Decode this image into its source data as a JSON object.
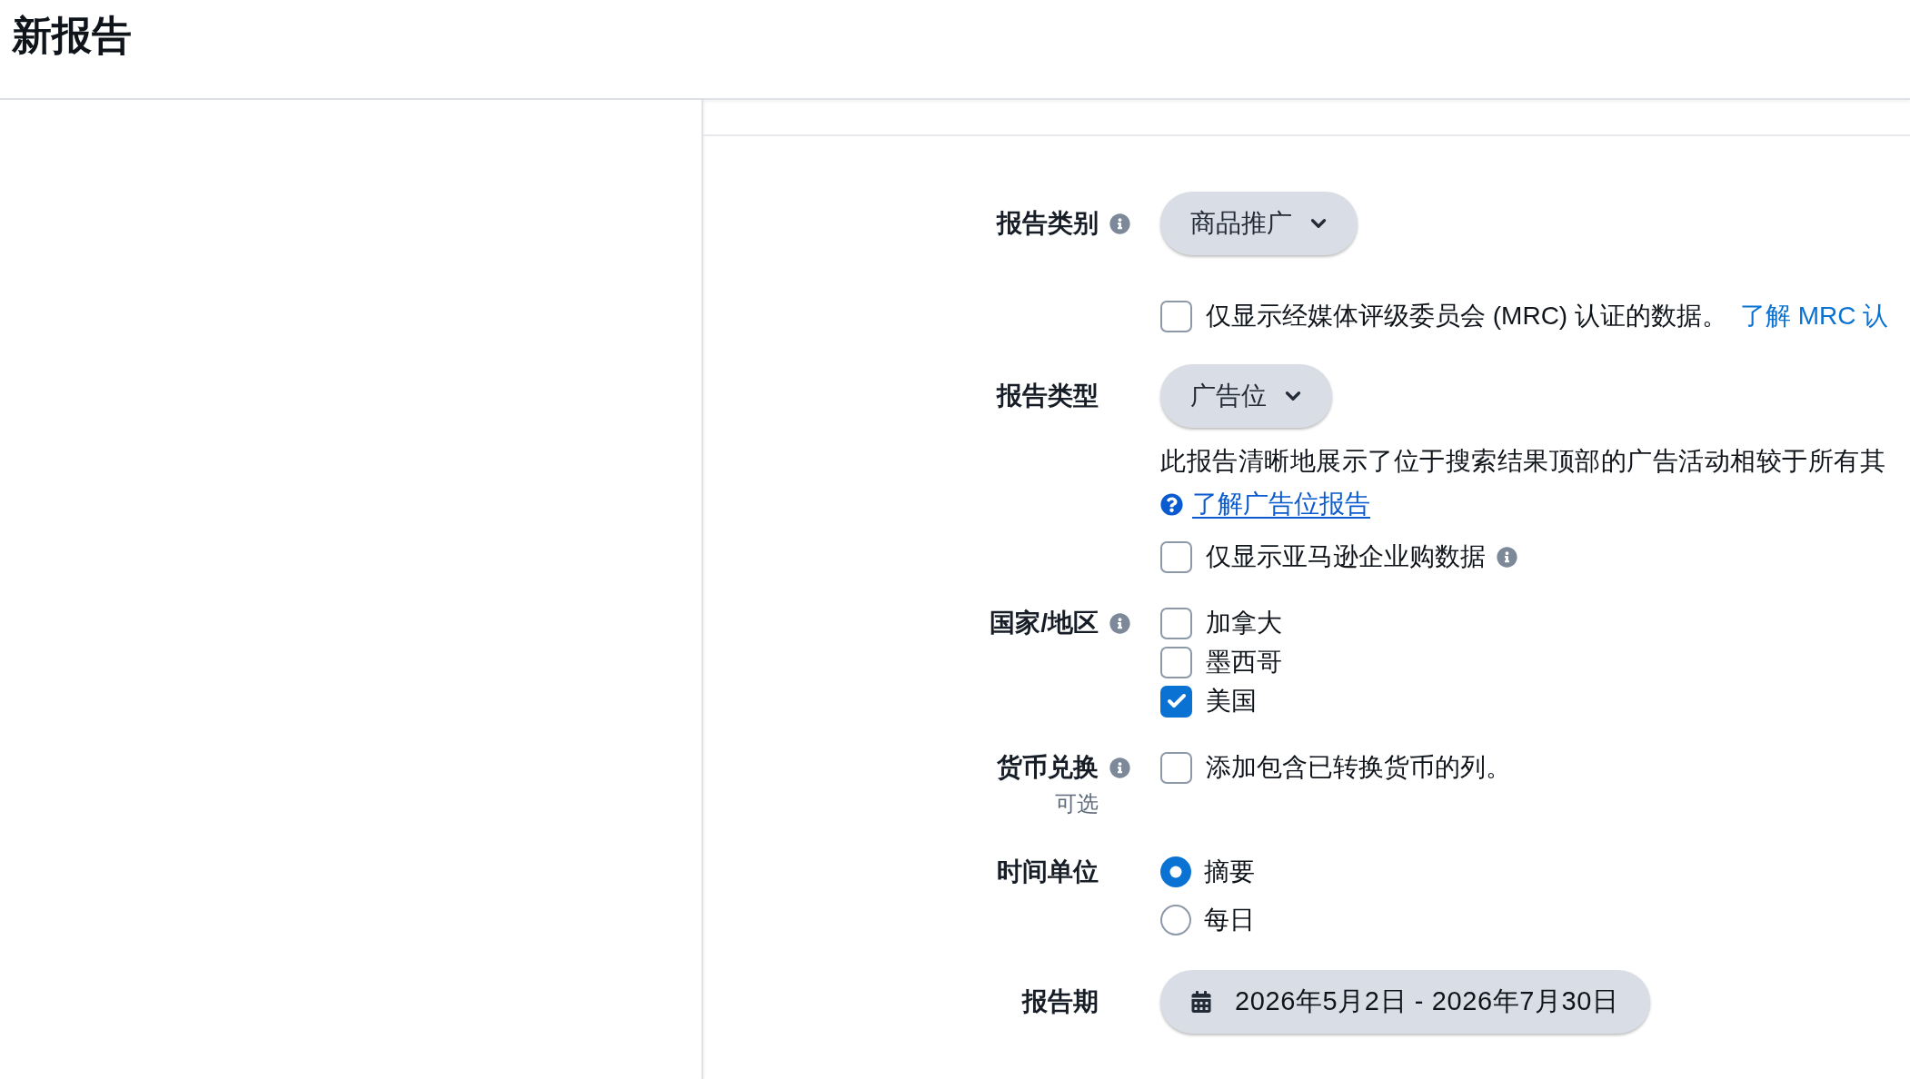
{
  "header": {
    "title": "新报告"
  },
  "fields": [
    {
      "kind": "select",
      "label": "报告类别",
      "info": true,
      "value": "商品推广",
      "extras": [
        {
          "kind": "checkbox",
          "text": "仅显示经媒体评级委员会 (MRC) 认证的数据。",
          "checked": false,
          "info": false,
          "link": "了解 MRC 认"
        }
      ]
    },
    {
      "kind": "select",
      "label": "报告类型",
      "info": false,
      "value": "广告位",
      "extras": [
        {
          "kind": "description",
          "text": "此报告清晰地展示了位于搜索结果顶部的广告活动相较于所有其"
        },
        {
          "kind": "help_link",
          "text": "了解广告位报告"
        },
        {
          "kind": "checkbox",
          "text": "仅显示亚马逊企业购数据",
          "checked": false,
          "info": true
        }
      ]
    },
    {
      "kind": "checkboxes",
      "label": "国家/地区",
      "info": true,
      "options": [
        {
          "text": "加拿大",
          "checked": false
        },
        {
          "text": "墨西哥",
          "checked": false
        },
        {
          "text": "美国",
          "checked": true
        }
      ]
    },
    {
      "kind": "checkboxes",
      "label": "货币兑换",
      "info": true,
      "hint": "可选",
      "options": [
        {
          "text": "添加包含已转换货币的列。",
          "checked": false
        }
      ]
    },
    {
      "kind": "radios",
      "label": "时间单位",
      "info": false,
      "options": [
        {
          "text": "摘要",
          "selected": true
        },
        {
          "text": "每日",
          "selected": false
        }
      ]
    },
    {
      "kind": "date_range",
      "label": "报告期",
      "info": false,
      "value": "2026年5月2日 - 2026年7月30日"
    }
  ]
}
